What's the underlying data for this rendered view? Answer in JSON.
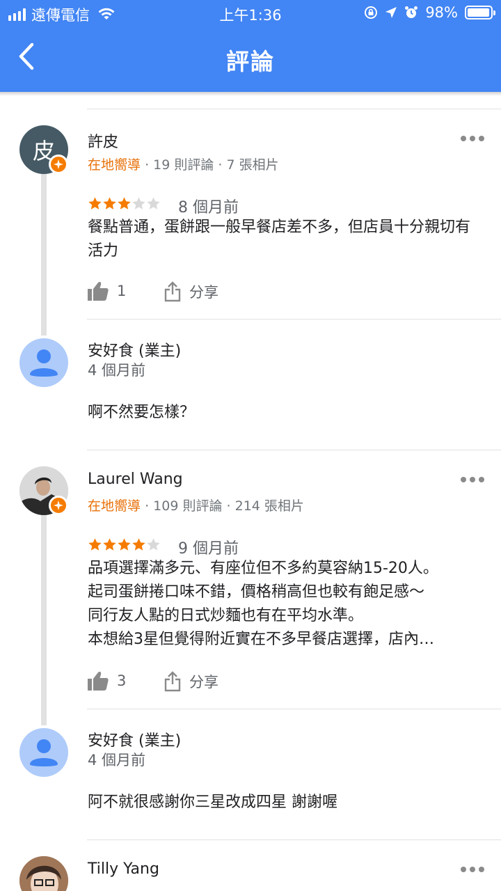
{
  "status_bar": {
    "carrier": "遠傳電信",
    "time": "上午1:36",
    "battery": "98%",
    "battery_level": 0.98
  },
  "header": {
    "title": "評論",
    "back_icon": "chevron-left-icon"
  },
  "reviews": [
    {
      "avatar_letter": "皮",
      "name": "許皮",
      "badge": "在地嚮導",
      "reviews_count": "19 則評論",
      "photos_count": "7 張相片",
      "rating": 3,
      "ago": "8 個月前",
      "text": "餐點普通，蛋餅跟一般早餐店差不多，但店員十分親切有活力",
      "likes": "1",
      "share": "分享",
      "reply": {
        "name": "安好食 (業主)",
        "ago": "4 個月前",
        "text": "啊不然要怎樣？"
      }
    },
    {
      "name": "Laurel Wang",
      "badge": "在地嚮導",
      "reviews_count": "109 則評論",
      "photos_count": "214 張相片",
      "rating": 4,
      "ago": "9 個月前",
      "text_lines": [
        "品項選擇滿多元、有座位但不多約莫容納15-20人。",
        "起司蛋餅捲口味不錯，價格稍高但也較有飽足感～",
        "同行友人點的日式炒麵也有在平均水準。",
        "本想給3星但覺得附近實在不多早餐店選擇，店內…"
      ],
      "likes": "3",
      "share": "分享",
      "reply": {
        "name": "安好食 (業主)",
        "ago": "4 個月前",
        "text": "阿不就很感謝你三星改成四星 謝謝喔"
      }
    },
    {
      "name": "Tilly Yang"
    }
  ],
  "colors": {
    "header_bg": "#4285f4",
    "star_filled": "#f57c00",
    "star_empty": "#d9d9d9",
    "local_guide": "#e8710a",
    "owner_avatar": "#aecbfa"
  }
}
